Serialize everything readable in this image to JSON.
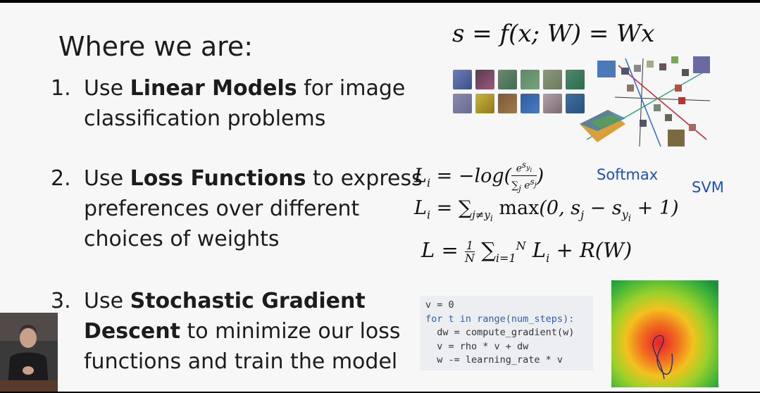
{
  "slide": {
    "title": "Where we are:",
    "items": [
      {
        "num": "1.",
        "prefix": "Use ",
        "bold": "Linear Models",
        "rest": " for image",
        "line2": "classification problems"
      },
      {
        "num": "2.",
        "prefix": "Use ",
        "bold": "Loss Functions",
        "rest": " to express",
        "line2": "preferences over different",
        "line3": "choices of weights"
      },
      {
        "num": "3.",
        "prefix": "Use ",
        "bold": "Stochastic Gradient",
        "line2_bold": "Descent",
        "line2_rest": " to minimize our loss",
        "line3": "functions and train the model"
      }
    ],
    "labels": {
      "softmax": "Softmax",
      "svm": "SVM"
    },
    "code_lines": [
      "v = 0",
      "for t in range(num_steps):",
      "  dw = compute_gradient(w)",
      "  v = rho * v + dw",
      "  w -= learning_rate * v"
    ]
  },
  "colors": {
    "accent_blue": "#1f4fb8",
    "text": "#1c1c1c"
  }
}
